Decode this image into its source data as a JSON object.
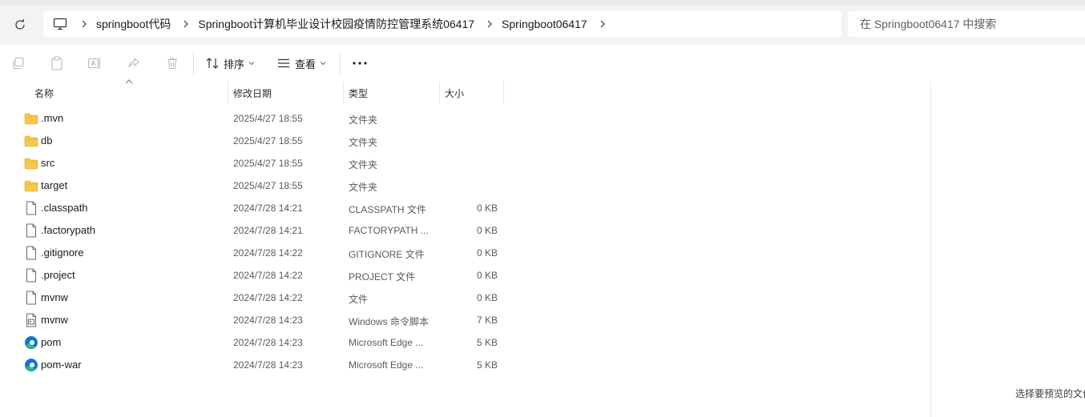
{
  "address_bar": {
    "breadcrumbs": [
      "springboot代码",
      "Springboot计算机毕业设计校园疫情防控管理系统06417",
      "Springboot06417"
    ],
    "root_icon": "this-pc-icon",
    "search_placeholder": "在 Springboot06417 中搜索"
  },
  "toolbar": {
    "icons": [
      "new-icon",
      "paste-icon",
      "rename-icon",
      "share-icon",
      "delete-icon"
    ],
    "sort_label": "排序",
    "view_label": "查看",
    "more_label": "···"
  },
  "columns": {
    "name": "名称",
    "modified": "修改日期",
    "type": "类型",
    "size": "大小",
    "sorted_by": "name"
  },
  "files": [
    {
      "name": ".mvn",
      "modified": "2025/4/27 18:55",
      "type": "文件夹",
      "size": "",
      "icon": "folder-icon"
    },
    {
      "name": "db",
      "modified": "2025/4/27 18:55",
      "type": "文件夹",
      "size": "",
      "icon": "folder-icon"
    },
    {
      "name": "src",
      "modified": "2025/4/27 18:55",
      "type": "文件夹",
      "size": "",
      "icon": "folder-icon"
    },
    {
      "name": "target",
      "modified": "2025/4/27 18:55",
      "type": "文件夹",
      "size": "",
      "icon": "folder-icon"
    },
    {
      "name": ".classpath",
      "modified": "2024/7/28 14:21",
      "type": "CLASSPATH 文件",
      "size": "0 KB",
      "icon": "file-icon"
    },
    {
      "name": ".factorypath",
      "modified": "2024/7/28 14:21",
      "type": "FACTORYPATH ...",
      "size": "0 KB",
      "icon": "file-icon"
    },
    {
      "name": ".gitignore",
      "modified": "2024/7/28 14:22",
      "type": "GITIGNORE 文件",
      "size": "0 KB",
      "icon": "file-icon"
    },
    {
      "name": ".project",
      "modified": "2024/7/28 14:22",
      "type": "PROJECT 文件",
      "size": "0 KB",
      "icon": "file-icon"
    },
    {
      "name": "mvnw",
      "modified": "2024/7/28 14:22",
      "type": "文件",
      "size": "0 KB",
      "icon": "file-icon"
    },
    {
      "name": "mvnw",
      "modified": "2024/7/28 14:23",
      "type": "Windows 命令脚本",
      "size": "7 KB",
      "icon": "script-file-icon"
    },
    {
      "name": "pom",
      "modified": "2024/7/28 14:23",
      "type": "Microsoft Edge ...",
      "size": "5 KB",
      "icon": "edge-icon"
    },
    {
      "name": "pom-war",
      "modified": "2024/7/28 14:23",
      "type": "Microsoft Edge ...",
      "size": "5 KB",
      "icon": "edge-icon"
    }
  ],
  "preview_pane": {
    "message": "选择要预览的文件"
  },
  "colors": {
    "folder": "#f8c84a",
    "edge_blue": "#0f78d4",
    "edge_green": "#36c06b"
  }
}
